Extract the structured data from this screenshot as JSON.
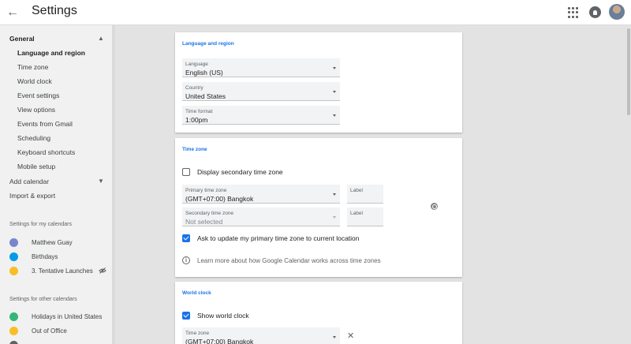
{
  "header": {
    "title": "Settings"
  },
  "sidebar": {
    "general": {
      "label": "General"
    },
    "general_items": [
      {
        "label": "Language and region"
      },
      {
        "label": "Time zone"
      },
      {
        "label": "World clock"
      },
      {
        "label": "Event settings"
      },
      {
        "label": "View options"
      },
      {
        "label": "Events from Gmail"
      },
      {
        "label": "Scheduling"
      },
      {
        "label": "Keyboard shortcuts"
      },
      {
        "label": "Mobile setup"
      }
    ],
    "add_calendar": {
      "label": "Add calendar"
    },
    "import_export": {
      "label": "Import & export"
    },
    "my_calendars": {
      "heading": "Settings for my calendars",
      "items": [
        {
          "label": "Matthew Guay",
          "color": "#7986cb"
        },
        {
          "label": "Birthdays",
          "color": "#039be5"
        },
        {
          "label": "3. Tentative Launches",
          "color": "#f6bf26"
        }
      ]
    },
    "other_calendars": {
      "heading": "Settings for other calendars",
      "items": [
        {
          "label": "Holidays in United States",
          "color": "#33b679"
        },
        {
          "label": "Out of Office",
          "color": "#f6bf26"
        },
        {
          "label": "",
          "color": "#616161"
        }
      ]
    }
  },
  "language_region": {
    "title": "Language and region",
    "language": {
      "caption": "Language",
      "value": "English (US)"
    },
    "country": {
      "caption": "Country",
      "value": "United States"
    },
    "time_format": {
      "caption": "Time format",
      "value": "1:00pm"
    }
  },
  "time_zone": {
    "title": "Time zone",
    "secondary_checkbox": {
      "label": "Display secondary time zone",
      "checked": false
    },
    "primary": {
      "caption": "Primary time zone",
      "value": "(GMT+07:00) Bangkok"
    },
    "primary_label_caption": "Label",
    "secondary": {
      "caption": "Secondary time zone",
      "value": "Not selected"
    },
    "secondary_label_caption": "Label",
    "ask_update": {
      "label": "Ask to update my primary time zone to current location",
      "checked": true
    },
    "learn_more": "Learn more about how Google Calendar works across time zones"
  },
  "world_clock": {
    "title": "World clock",
    "show_checkbox": {
      "label": "Show world clock",
      "checked": true
    },
    "time_zone": {
      "caption": "Time zone",
      "value": "(GMT+07:00) Bangkok"
    }
  }
}
